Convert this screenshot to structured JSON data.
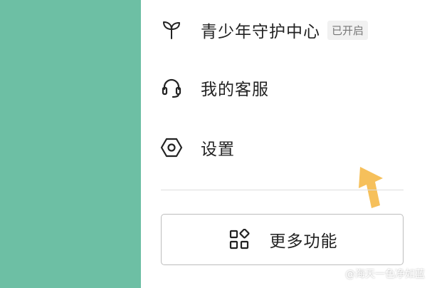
{
  "menu": {
    "items": [
      {
        "label": "青少年守护中心",
        "badge": "已开启",
        "icon": "sprout-icon"
      },
      {
        "label": "我的客服",
        "icon": "headset-icon"
      },
      {
        "label": "设置",
        "icon": "hexagon-gear-icon"
      }
    ],
    "more_button": {
      "label": "更多功能",
      "icon": "apps-grid-icon"
    }
  },
  "annotation": {
    "icon": "up-arrow-pointer",
    "color": "#f6c05b"
  },
  "watermark": "@海天一色净如蓝",
  "colors": {
    "left_panel": "#6dbfa4",
    "text": "#222222"
  }
}
